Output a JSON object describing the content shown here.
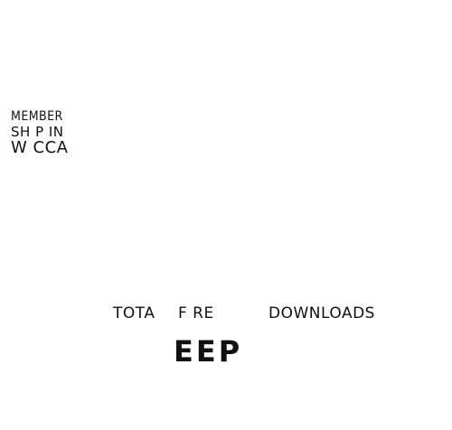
{
  "note": {
    "line1": "MEMBER",
    "line2": "SH P IN",
    "line3": "W CCA"
  },
  "downloads": {
    "total": "TOTA",
    "free": "F RE",
    "downloads": "DOWNLOADS"
  },
  "headline": "EEP"
}
